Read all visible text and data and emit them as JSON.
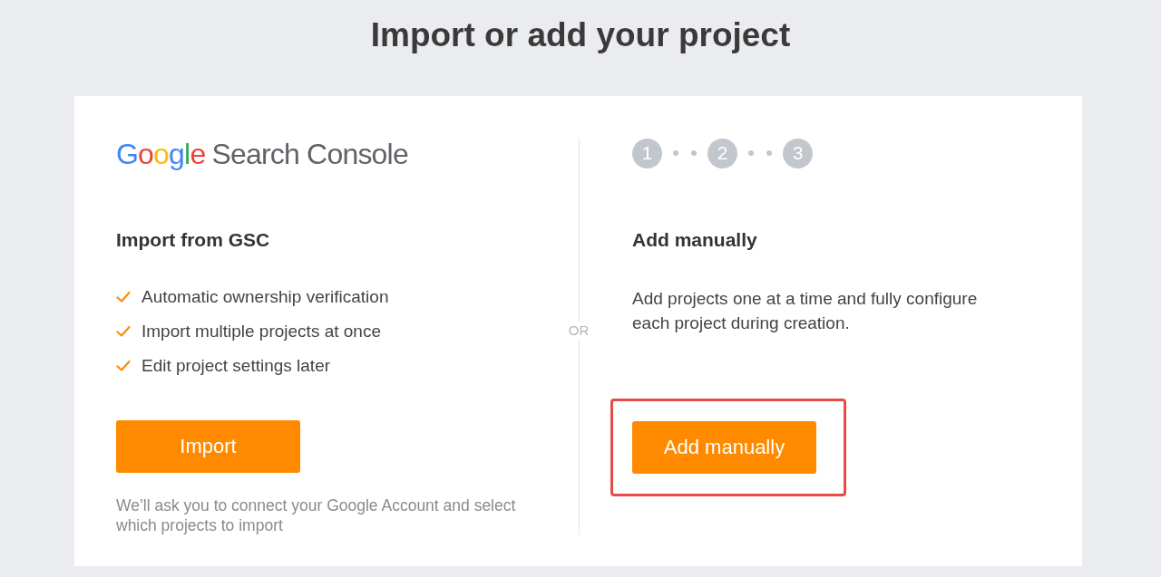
{
  "page_title": "Import or add your project",
  "gsc": {
    "logo_brand": "Google",
    "logo_product": "Search Console",
    "heading": "Import from GSC",
    "features": [
      "Automatic ownership verification",
      "Import multiple projects at once",
      "Edit project settings later"
    ],
    "button": "Import",
    "note": "We’ll ask you to connect your Google Account and select which projects to import"
  },
  "separator": "OR",
  "manual": {
    "steps": [
      "1",
      "2",
      "3"
    ],
    "heading": "Add manually",
    "description": "Add projects one at a time and fully configure each project during creation.",
    "button": "Add manually",
    "highlighted": true
  }
}
